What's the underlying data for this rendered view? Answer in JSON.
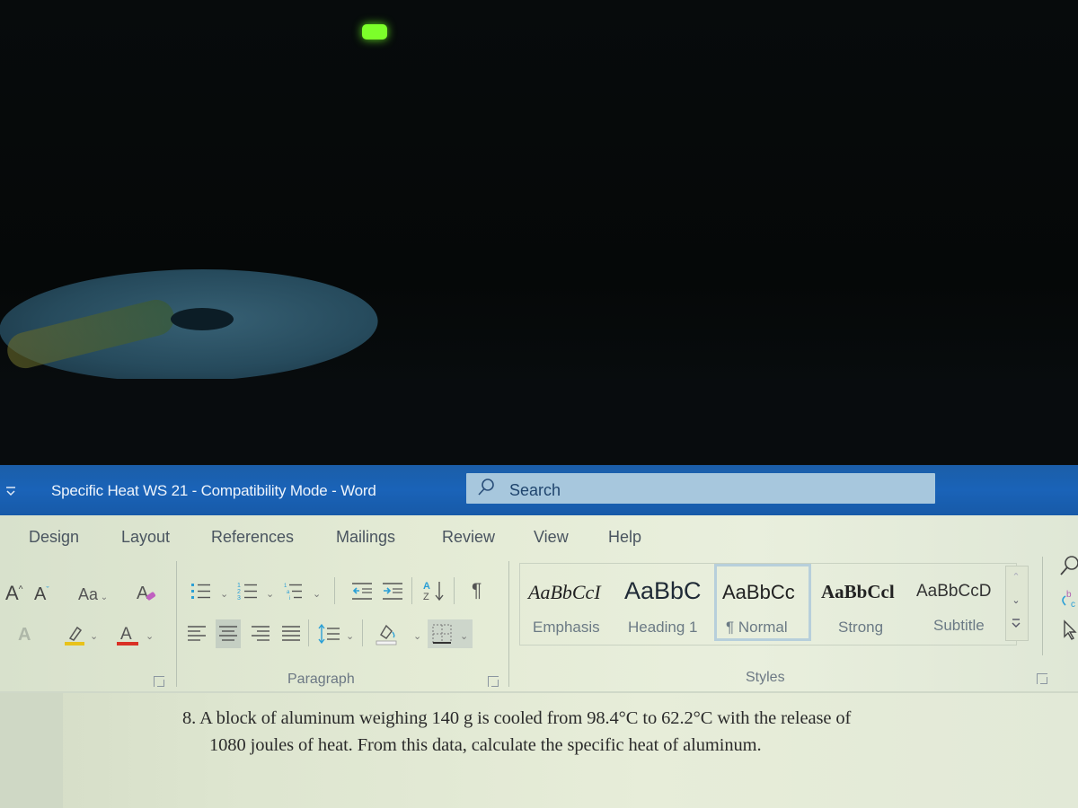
{
  "window": {
    "title": "Specific Heat WS 21  -  Compatibility Mode  -  Word",
    "search_placeholder": "Search",
    "quick_access_icon": "customize-qat-icon"
  },
  "ribbon": {
    "tabs": [
      {
        "label": "Design"
      },
      {
        "label": "Layout"
      },
      {
        "label": "References"
      },
      {
        "label": "Mailings"
      },
      {
        "label": "Review"
      },
      {
        "label": "View"
      },
      {
        "label": "Help"
      }
    ],
    "font_group": {
      "grow_font_icon": "A^",
      "shrink_font_icon": "Aˇ",
      "change_case_label": "Aa",
      "clear_formatting_icon": "clear-formatting-icon",
      "text_effects_icon": "A",
      "highlight_color": "#e8c21a",
      "font_color": "#d93025",
      "font_color_letter": "A"
    },
    "paragraph_group": {
      "label": "Paragraph",
      "sort_icon": "A↓Z",
      "pilcrow": "¶"
    },
    "styles_group": {
      "label": "Styles",
      "styles": [
        {
          "preview": "AaBbCcI",
          "name": "Emphasis"
        },
        {
          "preview": "AaBbC",
          "name": "Heading 1"
        },
        {
          "preview": "AaBbCc",
          "name": "¶ Normal",
          "selected": true
        },
        {
          "preview": "AaBbCcl",
          "name": "Strong"
        },
        {
          "preview": "AaBbCcD",
          "name": "Subtitle"
        }
      ]
    }
  },
  "document": {
    "lines": [
      "8.  A block of aluminum weighing 140 g is cooled from 98.4°C to 62.2°C with the release of",
      "1080 joules of heat. From this data, calculate the specific heat of aluminum."
    ]
  },
  "colors": {
    "title_bar": "#1a63b8",
    "search_box": "#a7c7dd",
    "ribbon_bg": "#e4ebd5",
    "led": "#7cff2a"
  }
}
